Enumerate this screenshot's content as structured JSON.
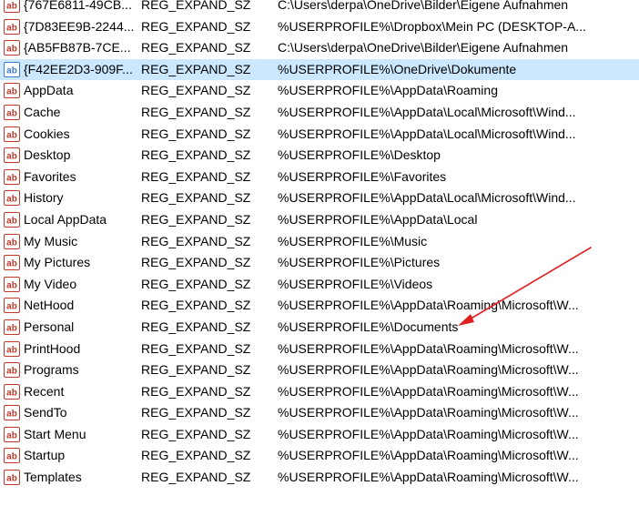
{
  "accent": {
    "icon_red": "#c0392b",
    "icon_blue": "#3a7bd5",
    "arrow": "#e02020",
    "selection": "#cce8ff"
  },
  "icons": {
    "string_value": "reg-string-icon"
  },
  "rows": [
    {
      "name": "{767E6811-49CB...",
      "type": "REG_EXPAND_SZ",
      "data": "C:\\Users\\derpa\\OneDrive\\Bilder\\Eigene Aufnahmen",
      "selected": false
    },
    {
      "name": "{7D83EE9B-2244...",
      "type": "REG_EXPAND_SZ",
      "data": "%USERPROFILE%\\Dropbox\\Mein PC (DESKTOP-A...",
      "selected": false
    },
    {
      "name": "{AB5FB87B-7CE...",
      "type": "REG_EXPAND_SZ",
      "data": "C:\\Users\\derpa\\OneDrive\\Bilder\\Eigene Aufnahmen",
      "selected": false
    },
    {
      "name": "{F42EE2D3-909F...",
      "type": "REG_EXPAND_SZ",
      "data": "%USERPROFILE%\\OneDrive\\Dokumente",
      "selected": true
    },
    {
      "name": "AppData",
      "type": "REG_EXPAND_SZ",
      "data": "%USERPROFILE%\\AppData\\Roaming",
      "selected": false
    },
    {
      "name": "Cache",
      "type": "REG_EXPAND_SZ",
      "data": "%USERPROFILE%\\AppData\\Local\\Microsoft\\Wind...",
      "selected": false
    },
    {
      "name": "Cookies",
      "type": "REG_EXPAND_SZ",
      "data": "%USERPROFILE%\\AppData\\Local\\Microsoft\\Wind...",
      "selected": false
    },
    {
      "name": "Desktop",
      "type": "REG_EXPAND_SZ",
      "data": "%USERPROFILE%\\Desktop",
      "selected": false
    },
    {
      "name": "Favorites",
      "type": "REG_EXPAND_SZ",
      "data": "%USERPROFILE%\\Favorites",
      "selected": false
    },
    {
      "name": "History",
      "type": "REG_EXPAND_SZ",
      "data": "%USERPROFILE%\\AppData\\Local\\Microsoft\\Wind...",
      "selected": false
    },
    {
      "name": "Local AppData",
      "type": "REG_EXPAND_SZ",
      "data": "%USERPROFILE%\\AppData\\Local",
      "selected": false
    },
    {
      "name": "My Music",
      "type": "REG_EXPAND_SZ",
      "data": "%USERPROFILE%\\Music",
      "selected": false
    },
    {
      "name": "My Pictures",
      "type": "REG_EXPAND_SZ",
      "data": "%USERPROFILE%\\Pictures",
      "selected": false
    },
    {
      "name": "My Video",
      "type": "REG_EXPAND_SZ",
      "data": "%USERPROFILE%\\Videos",
      "selected": false
    },
    {
      "name": "NetHood",
      "type": "REG_EXPAND_SZ",
      "data": "%USERPROFILE%\\AppData\\Roaming\\Microsoft\\W...",
      "selected": false
    },
    {
      "name": "Personal",
      "type": "REG_EXPAND_SZ",
      "data": "%USERPROFILE%\\Documents",
      "selected": false
    },
    {
      "name": "PrintHood",
      "type": "REG_EXPAND_SZ",
      "data": "%USERPROFILE%\\AppData\\Roaming\\Microsoft\\W...",
      "selected": false
    },
    {
      "name": "Programs",
      "type": "REG_EXPAND_SZ",
      "data": "%USERPROFILE%\\AppData\\Roaming\\Microsoft\\W...",
      "selected": false
    },
    {
      "name": "Recent",
      "type": "REG_EXPAND_SZ",
      "data": "%USERPROFILE%\\AppData\\Roaming\\Microsoft\\W...",
      "selected": false
    },
    {
      "name": "SendTo",
      "type": "REG_EXPAND_SZ",
      "data": "%USERPROFILE%\\AppData\\Roaming\\Microsoft\\W...",
      "selected": false
    },
    {
      "name": "Start Menu",
      "type": "REG_EXPAND_SZ",
      "data": "%USERPROFILE%\\AppData\\Roaming\\Microsoft\\W...",
      "selected": false
    },
    {
      "name": "Startup",
      "type": "REG_EXPAND_SZ",
      "data": "%USERPROFILE%\\AppData\\Roaming\\Microsoft\\W...",
      "selected": false
    },
    {
      "name": "Templates",
      "type": "REG_EXPAND_SZ",
      "data": "%USERPROFILE%\\AppData\\Roaming\\Microsoft\\W...",
      "selected": false
    }
  ]
}
